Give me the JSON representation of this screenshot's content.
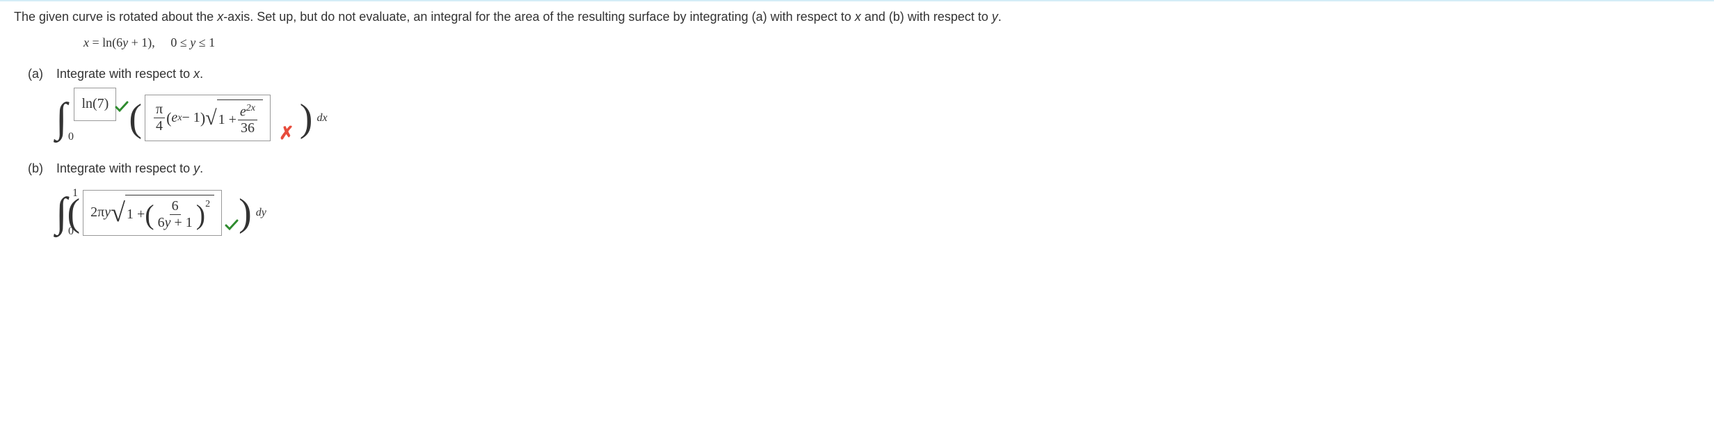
{
  "problem": {
    "statement_pre": "The given curve is rotated about the ",
    "axis": "x",
    "statement_mid": "-axis. Set up, but do not evaluate, an integral for the area of the resulting surface by integrating (a) with respect to ",
    "var_x": "x",
    "statement_and": " and (b) with respect to ",
    "var_y": "y",
    "statement_end": ".",
    "curve_lhs": "x",
    "curve_eq": " = ln(6",
    "curve_y": "y",
    "curve_rhs": " + 1),",
    "domain": "0 ≤ ",
    "domain_y": "y",
    "domain_end": " ≤ 1"
  },
  "part_a": {
    "letter": "(a)",
    "label_pre": "Integrate with respect to ",
    "var": "x",
    "label_end": ".",
    "lower_limit": "0",
    "upper_limit_answer": "ln(7)",
    "integrand": {
      "pi_num": "π",
      "pi_den": "4",
      "e": "e",
      "exp_x": "x",
      "minus1": " − 1",
      "one_plus": "1 + ",
      "e2x_num_e": "e",
      "e2x_num_exp": "2x",
      "denom": "36"
    },
    "differential": "dx"
  },
  "part_b": {
    "letter": "(b)",
    "label_pre": "Integrate with respect to ",
    "var": "y",
    "label_end": ".",
    "lower_limit": "0",
    "upper_limit": "1",
    "integrand": {
      "two_pi": "2π",
      "y": "y",
      "one_plus": "1 + ",
      "inner_num": "6",
      "inner_den_pre": "6",
      "inner_den_y": "y",
      "inner_den_post": " + 1",
      "exponent": "2"
    },
    "differential": "dy"
  },
  "chart_data": {
    "type": "table",
    "title": "Surface of revolution integral setup",
    "curve": "x = ln(6y + 1), 0 ≤ y ≤ 1",
    "axis_of_rotation": "x-axis",
    "answers": [
      {
        "part": "a",
        "variable": "x",
        "upper_limit": "ln(7)",
        "upper_limit_correct": true,
        "lower_limit": "0",
        "integrand": "(π/4)(e^x − 1) √(1 + e^{2x}/36)",
        "integrand_correct": false
      },
      {
        "part": "b",
        "variable": "y",
        "upper_limit": "1",
        "lower_limit": "0",
        "integrand": "2πy √(1 + (6/(6y+1))^2)",
        "integrand_correct": true
      }
    ]
  }
}
